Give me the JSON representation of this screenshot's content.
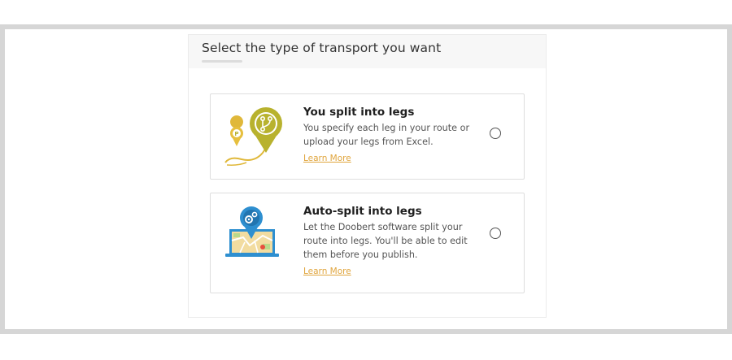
{
  "panel": {
    "title": "Select the type of transport you want"
  },
  "options": [
    {
      "title": "You split into legs",
      "description": "You specify each leg in your route or upload your legs from Excel.",
      "learn_more": "Learn More",
      "icon": "route-pin-icon",
      "pin_label": "P",
      "selected": false
    },
    {
      "title": "Auto-split into legs",
      "description": "Let the Doobert software split your route into legs. You'll be able to edit them before you publish.",
      "learn_more": "Learn More",
      "icon": "laptop-map-gear-icon",
      "selected": false
    }
  ],
  "colors": {
    "accent": "#e0a53d",
    "pin_olive": "#b8b22e",
    "pin_blue": "#2e8fd0"
  }
}
